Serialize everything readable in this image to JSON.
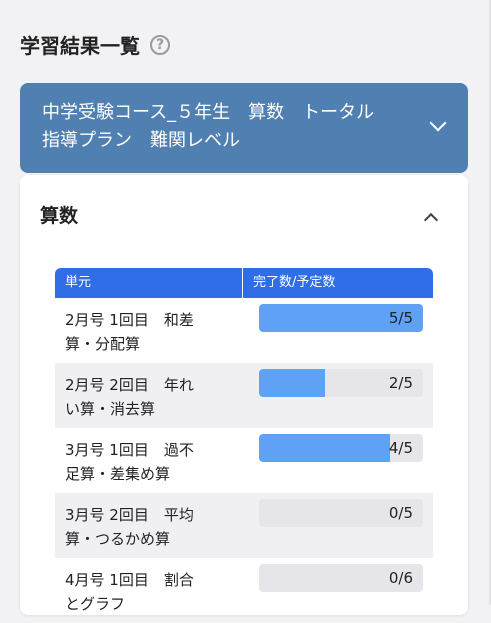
{
  "page": {
    "title": "学習結果一覧",
    "help_icon": "question-circle-icon"
  },
  "plan_select": {
    "line1": "中学受験コース_５年生　算数　トータル",
    "line2": "指導プラン　難関レベル",
    "icon": "chevron-down-icon"
  },
  "subject": {
    "title": "算数",
    "icon": "chevron-up-icon"
  },
  "table": {
    "headers": {
      "unit": "単元",
      "progress": "完了数/予定数"
    },
    "rows": [
      {
        "line1": "2月号 1回目　和差",
        "line2": "算・分配算",
        "completed": 5,
        "planned": 5,
        "label": "5/5"
      },
      {
        "line1": "2月号 2回目　年れ",
        "line2": "い算・消去算",
        "completed": 2,
        "planned": 5,
        "label": "2/5"
      },
      {
        "line1": "3月号 1回目　過不",
        "line2": "足算・差集め算",
        "completed": 4,
        "planned": 5,
        "label": "4/5"
      },
      {
        "line1": "3月号 2回目　平均",
        "line2": "算・つるかめ算",
        "completed": 0,
        "planned": 5,
        "label": "0/5"
      },
      {
        "line1": "4月号 1回目　割合",
        "line2": "とグラフ",
        "completed": 0,
        "planned": 6,
        "label": "0/6"
      }
    ]
  },
  "colors": {
    "accent": "#5080b2",
    "header": "#2f6ee6",
    "bar_fill": "#5ea1f5",
    "bar_track": "#e6e6ea"
  }
}
